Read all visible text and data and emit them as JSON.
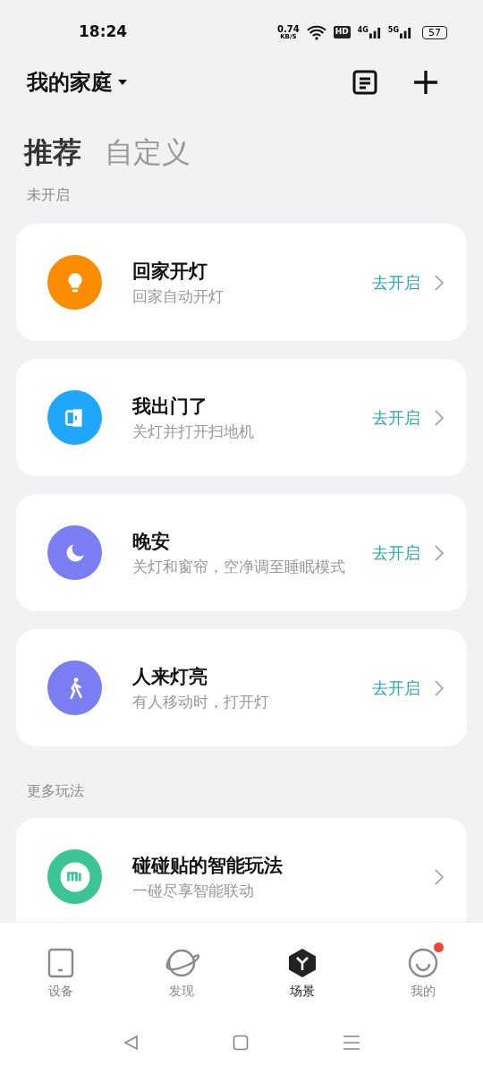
{
  "status_bar": {
    "time": "18:24",
    "speed": "0.74",
    "speed_unit": "KB/S",
    "hd": "HD",
    "net1": "4G",
    "net2": "5G",
    "battery": "57"
  },
  "header": {
    "home": "我的家庭"
  },
  "tabs": [
    {
      "label": "推荐",
      "selected": true
    },
    {
      "label": "自定义",
      "selected": false
    }
  ],
  "sections": [
    {
      "title": "未开启",
      "scenes": [
        {
          "kind": "bulb",
          "color": "#fb8c00",
          "title": "回家开灯",
          "subtitle": "回家自动开灯",
          "action": "去开启"
        },
        {
          "kind": "door",
          "color": "#1ea7fd",
          "title": "我出门了",
          "subtitle": "关灯并打开扫地机",
          "action": "去开启"
        },
        {
          "kind": "moon",
          "color": "#7b7ef2",
          "title": "晚安",
          "subtitle": "关灯和窗帘，空净调至睡眠模式",
          "action": "去开启"
        },
        {
          "kind": "walk",
          "color": "#7b7ef2",
          "title": "人来灯亮",
          "subtitle": "有人移动时，打开灯",
          "action": "去开启"
        }
      ]
    },
    {
      "title": "更多玩法",
      "scenes": [
        {
          "kind": "mi",
          "color": "#3cc497",
          "title": "碰碰贴的智能玩法",
          "subtitle": "一碰尽享智能联动"
        }
      ]
    }
  ],
  "nav": [
    {
      "kind": "device",
      "label": "设备",
      "selected": false
    },
    {
      "kind": "planet",
      "label": "发现",
      "selected": false
    },
    {
      "kind": "scene",
      "label": "场景",
      "selected": true
    },
    {
      "kind": "face",
      "label": "我的",
      "selected": false,
      "badge": true
    }
  ]
}
